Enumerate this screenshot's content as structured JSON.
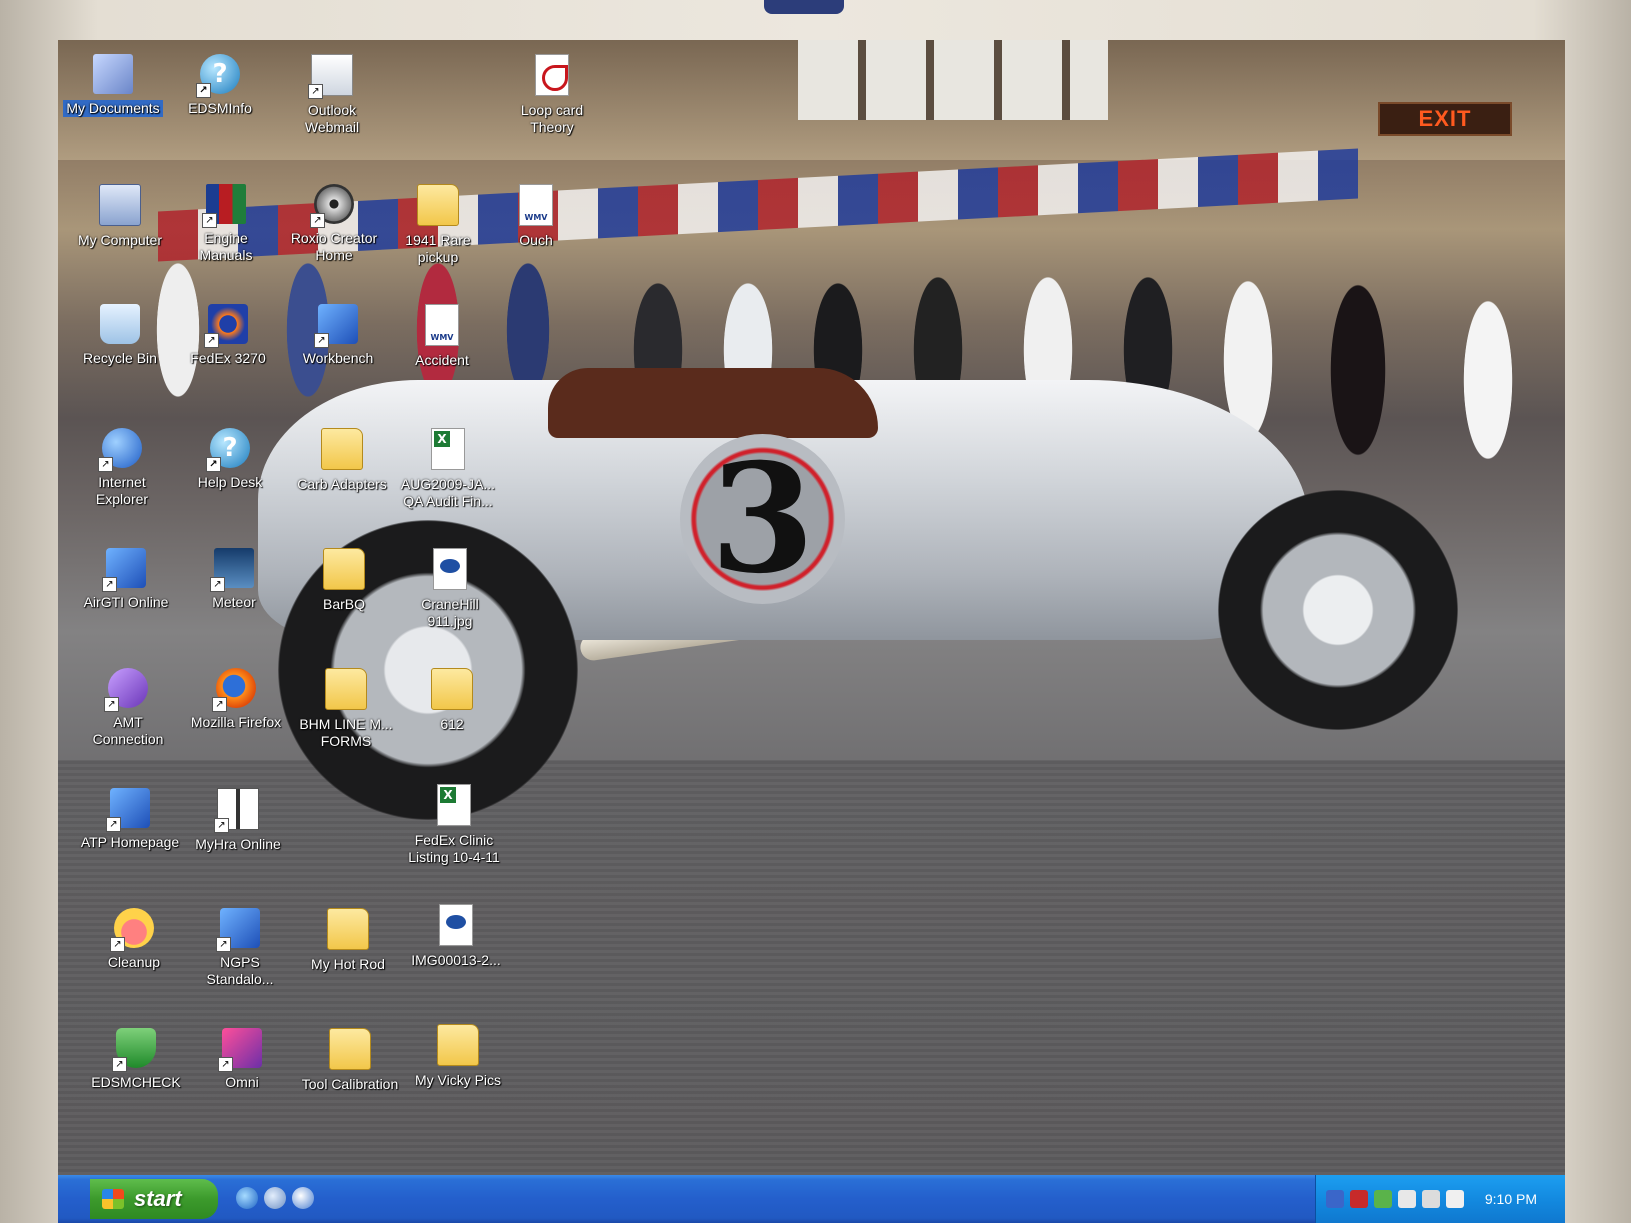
{
  "desktop": {
    "icons": [
      {
        "label": "My Documents"
      },
      {
        "label": "EDSMInfo"
      },
      {
        "label": "Outlook Webmail"
      },
      {
        "label": "Loop card Theory"
      },
      {
        "label": "My Computer"
      },
      {
        "label": "Engine Manuals"
      },
      {
        "label": "Roxio Creator Home"
      },
      {
        "label": "1941 Rare pickup"
      },
      {
        "label": "Ouch"
      },
      {
        "label": "Recycle Bin"
      },
      {
        "label": "FedEx 3270"
      },
      {
        "label": "Workbench"
      },
      {
        "label": "Accident"
      },
      {
        "label": "Internet Explorer"
      },
      {
        "label": "Help Desk"
      },
      {
        "label": "Carb Adapters"
      },
      {
        "label": "AUG2009-JA... QA Audit Fin..."
      },
      {
        "label": "AirGTI Online"
      },
      {
        "label": "Meteor"
      },
      {
        "label": "BarBQ"
      },
      {
        "label": "CraneHill 911.jpg"
      },
      {
        "label": "AMT Connection"
      },
      {
        "label": "Mozilla Firefox"
      },
      {
        "label": "BHM LINE M... FORMS"
      },
      {
        "label": "612"
      },
      {
        "label": "ATP Homepage"
      },
      {
        "label": "MyHra Online"
      },
      {
        "label": "FedEx Clinic Listing 10-4-11"
      },
      {
        "label": "Cleanup"
      },
      {
        "label": "NGPS Standalo..."
      },
      {
        "label": "My Hot Rod"
      },
      {
        "label": "IMG00013-2..."
      },
      {
        "label": "EDSMCHECK"
      },
      {
        "label": "Omni"
      },
      {
        "label": "Tool Calibration"
      },
      {
        "label": "My Vicky Pics"
      }
    ]
  },
  "wallpaper": {
    "exit_sign": "EXIT",
    "car_number": "3"
  },
  "taskbar": {
    "start_label": "start",
    "clock": "9:10 PM"
  },
  "colors": {
    "taskbar_blue": "#245fcc",
    "start_green": "#3c9a2c",
    "tray_blue": "#138ae0"
  }
}
